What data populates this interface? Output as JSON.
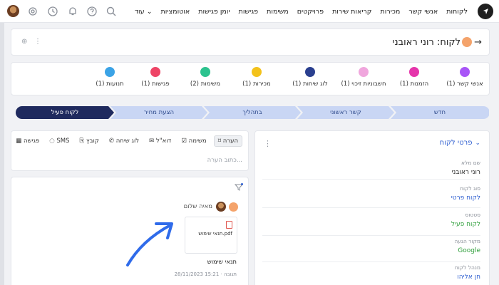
{
  "nav": {
    "items": [
      "לקוחות",
      "אנשי קשר",
      "מכירות",
      "קריאות שירות",
      "פרויקטים",
      "משימות",
      "פגישות",
      "יומן פגישות",
      "אוטומציות"
    ],
    "more": "עוד ⌄"
  },
  "header": {
    "title": "לקוח: רוני ראובני"
  },
  "related": [
    {
      "label": "אנשי קשר (1)",
      "color": "#a855f7"
    },
    {
      "label": "הזמנות (1)",
      "color": "#e535ab"
    },
    {
      "label": "חשבוניות זיכוי (1)",
      "color": "#f0a6dd"
    },
    {
      "label": "לוג שיחות (1)",
      "color": "#2a3f8f"
    },
    {
      "label": "מכירות (1)",
      "color": "#f3c21b"
    },
    {
      "label": "משימות (2)",
      "color": "#2cc28e"
    },
    {
      "label": "פגישות (1)",
      "color": "#ee4466"
    },
    {
      "label": "תנועות (1)",
      "color": "#3ba3e6"
    }
  ],
  "pipeline": {
    "stages": [
      "חדש",
      "קשר ראשוני",
      "בתהליך",
      "הצעת מחיר",
      "לקוח פעיל"
    ],
    "active_index": 4,
    "colors": {
      "inactive": "#c9d6f4",
      "active": "#1f2a5e"
    }
  },
  "activity": {
    "tabs": [
      "הערה",
      "משימה",
      "דוא\"ל",
      "לוג שיחה",
      "קובץ",
      "SMS",
      "פגישה"
    ],
    "placeholder": "כתוב הערה..."
  },
  "feed": {
    "user": "מאיה שלום",
    "file_name": "תנאי שימוש.pdf",
    "title": "תנאי שימוש",
    "meta": "28/11/2023 15:21 · תגובה"
  },
  "details": {
    "header": "פרטי לקוח",
    "fields": [
      {
        "label": "שם מלא",
        "value": "רוני ראובני",
        "color": "#222222"
      },
      {
        "label": "סוג לקוח",
        "value": "לקוח פרטי",
        "color": "#2f5fd0"
      },
      {
        "label": "סטטוס",
        "value": "לקוח פעיל",
        "color": "#2e9e3a"
      },
      {
        "label": "מקור הגעה",
        "value": "Google",
        "color": "#2e9e3a"
      },
      {
        "label": "מנהל לקוח",
        "value": "חן אליהו",
        "color": "#2f5fd0"
      }
    ]
  }
}
